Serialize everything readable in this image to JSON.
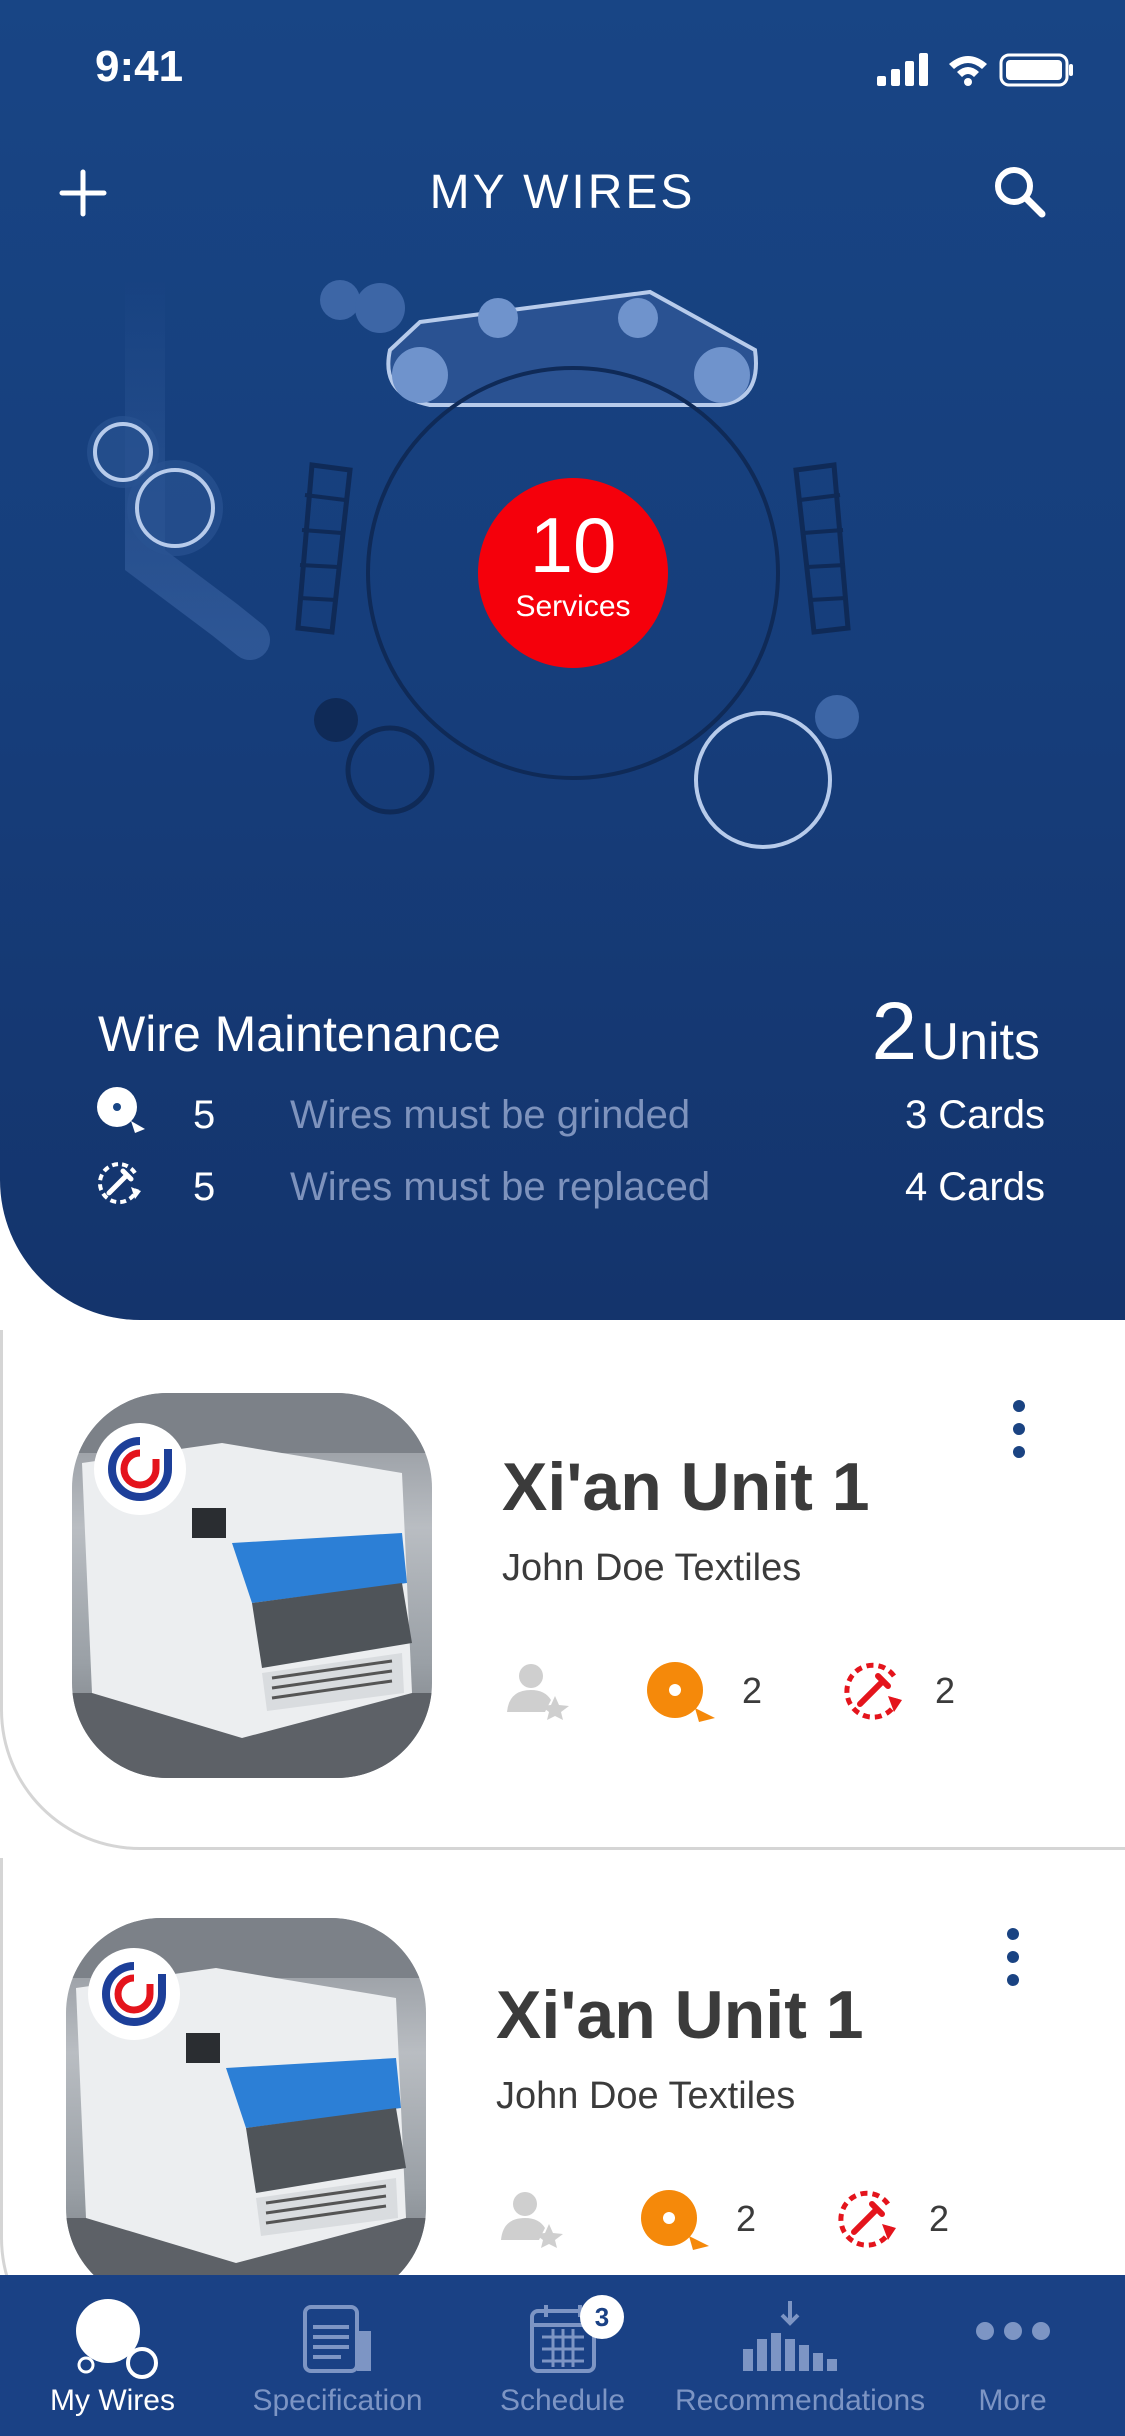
{
  "status": {
    "time": "9:41"
  },
  "header": {
    "title": "MY WIRES"
  },
  "services": {
    "count": "10",
    "label": "Services"
  },
  "maintenance": {
    "title": "Wire Maintenance",
    "units_count": "2",
    "units_label": "Units",
    "rows": [
      {
        "icon": "grind-icon",
        "count": "5",
        "text": "Wires must be grinded",
        "cards": "3 Cards"
      },
      {
        "icon": "replace-icon",
        "count": "5",
        "text": "Wires must be replaced",
        "cards": "4 Cards"
      }
    ]
  },
  "cards": [
    {
      "title": "Xi'an Unit 1",
      "subtitle": "John Doe Textiles",
      "grind_count": "2",
      "replace_count": "2"
    },
    {
      "title": "Xi'an Unit 1",
      "subtitle": "John Doe Textiles",
      "grind_count": "2",
      "replace_count": "2"
    }
  ],
  "tabs": [
    {
      "label": "My Wires",
      "icon": "wires-icon",
      "active": true
    },
    {
      "label": "Specification",
      "icon": "specification-icon"
    },
    {
      "label": "Schedule",
      "icon": "calendar-icon",
      "badge": "3"
    },
    {
      "label": "Recommendations",
      "icon": "chart-icon"
    },
    {
      "label": "More",
      "icon": "more-icon"
    }
  ],
  "colors": {
    "primary": "#184585",
    "alert": "#f5000b",
    "grind": "#f5890a",
    "replace": "#e4141c",
    "tab_inactive": "#7d95c4"
  }
}
